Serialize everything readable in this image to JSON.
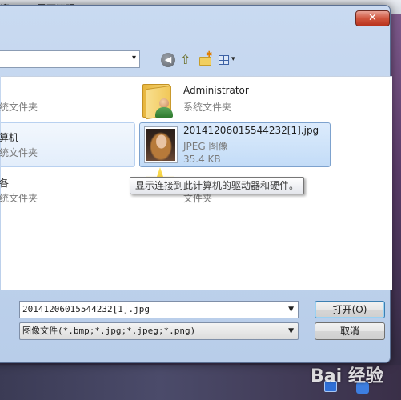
{
  "background": {
    "tabs": [
      "迎",
      "界面管理"
    ],
    "watermark": "Bai 经验"
  },
  "dialog": {
    "close_label": "✕",
    "toolbar": {
      "dropdown_arrow": "▾",
      "back_glyph": "◀",
      "up_glyph": "⇧"
    },
    "items": [
      {
        "name": "Administrator",
        "sub": "系统文件夹"
      },
      {
        "name": "20141206015544232[1].jpg",
        "type": "JPEG 图像",
        "size": "35.4 KB"
      },
      {
        "name": "",
        "sub": "文件夹"
      }
    ],
    "left_items": [
      {
        "name": "",
        "sub": "统文件夹"
      },
      {
        "name": "算机",
        "sub": "统文件夹"
      },
      {
        "name": "各",
        "sub": "统文件夹"
      }
    ],
    "tooltip": "显示连接到此计算机的驱动器和硬件。",
    "filename_value": "20141206015544232[1].jpg",
    "filetype_value": "图像文件(*.bmp;*.jpg;*.jpeg;*.png)",
    "open_label": "打开(O)",
    "cancel_label": "取消"
  },
  "colors": {
    "selection": "#c3dcf7",
    "close_button": "#d0563f",
    "dialog_frame": "#b8cde9"
  }
}
